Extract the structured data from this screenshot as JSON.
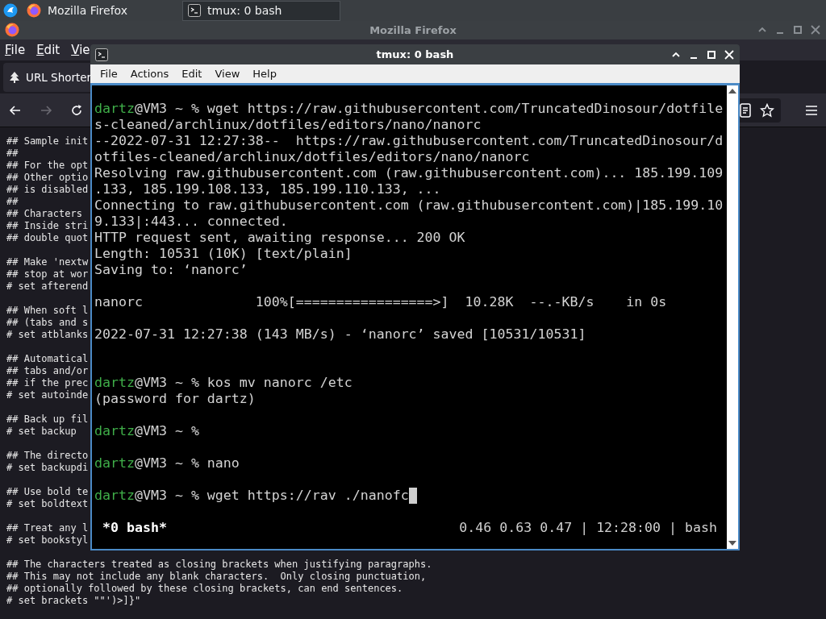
{
  "taskbar": {
    "tasks": [
      {
        "title": "Mozilla Firefox",
        "kind": "browser",
        "selected": false
      },
      {
        "title": "tmux: 0 bash",
        "kind": "terminal",
        "selected": true
      }
    ]
  },
  "firefox": {
    "title": "Mozilla Firefox",
    "menu": [
      "File",
      "Edit",
      "Vie"
    ],
    "tab": {
      "title": "URL Shorter"
    },
    "nav_buttons": [
      {
        "kind": "back",
        "disabled": false
      },
      {
        "kind": "forward",
        "disabled": true
      },
      {
        "kind": "reload",
        "disabled": false
      }
    ],
    "paragraphs": [
      {
        "lines": [
          "## Sample init",
          "##",
          "## For the opt",
          "## Other optio",
          "## is disabled",
          "##",
          "## Characters",
          "## Inside stri",
          "## double quot"
        ]
      },
      {
        "lines": [
          "## Make 'nextw",
          "## stop at wor",
          "# set afterend"
        ]
      },
      {
        "lines": [
          "## When soft l",
          "## (tabs and s",
          "# set atblanks"
        ]
      },
      {
        "lines": [
          "## Automatical",
          "## tabs and/or",
          "## if the prec",
          "# set autoinde"
        ]
      },
      {
        "lines": [
          "## Back up fil",
          "# set backup"
        ]
      },
      {
        "lines": [
          "## The directo",
          "# set backupdi"
        ]
      },
      {
        "lines": [
          "## Use bold te",
          "# set boldtext"
        ]
      },
      {
        "lines": [
          "## Treat any l",
          "# set bookstyl"
        ]
      },
      {
        "lines": [
          "## The characters treated as closing brackets when justifying paragraphs.",
          "## This may not include any blank characters.  Only closing punctuation,",
          "## optionally followed by these closing brackets, can end sentences.",
          "# set brackets \"\"')>]}\""
        ]
      }
    ]
  },
  "terminal": {
    "title": "tmux: 0 bash",
    "menu": [
      "File",
      "Actions",
      "Edit",
      "View",
      "Help"
    ],
    "lines": [
      {
        "kind": "prompt",
        "user": "dartz",
        "prompt": "@VM3 ~ %",
        "command": "wget https://raw.githubusercontent.com/TruncatedDinosour/dotfile",
        "cursor": false
      },
      {
        "kind": "output",
        "text": "s-cleaned/archlinux/dotfiles/editors/nano/nanorc"
      },
      {
        "kind": "output",
        "text": "--2022-07-31 12:27:38--  https://raw.githubusercontent.com/TruncatedDinosour/d"
      },
      {
        "kind": "output",
        "text": "otfiles-cleaned/archlinux/dotfiles/editors/nano/nanorc"
      },
      {
        "kind": "output",
        "text": "Resolving raw.githubusercontent.com (raw.githubusercontent.com)... 185.199.109"
      },
      {
        "kind": "output",
        "text": ".133, 185.199.108.133, 185.199.110.133, ..."
      },
      {
        "kind": "output",
        "text": "Connecting to raw.githubusercontent.com (raw.githubusercontent.com)|185.199.10"
      },
      {
        "kind": "output",
        "text": "9.133|:443... connected."
      },
      {
        "kind": "output",
        "text": "HTTP request sent, awaiting response... 200 OK"
      },
      {
        "kind": "output",
        "text": "Length: 10531 (10K) [text/plain]"
      },
      {
        "kind": "output",
        "text": "Saving to: ‘nanorc’"
      },
      {
        "kind": "blank"
      },
      {
        "kind": "output",
        "text": "nanorc              100%[=================>]  10.28K  --.-KB/s    in 0s"
      },
      {
        "kind": "blank"
      },
      {
        "kind": "output",
        "text": "2022-07-31 12:27:38 (143 MB/s) - ‘nanorc’ saved [10531/10531]"
      },
      {
        "kind": "blank"
      },
      {
        "kind": "blank"
      },
      {
        "kind": "prompt",
        "user": "dartz",
        "prompt": "@VM3 ~ %",
        "command": "kos mv nanorc /etc",
        "cursor": false
      },
      {
        "kind": "output",
        "text": "(password for dartz)"
      },
      {
        "kind": "blank"
      },
      {
        "kind": "prompt",
        "user": "dartz",
        "prompt": "@VM3 ~ %",
        "cursor": false
      },
      {
        "kind": "blank"
      },
      {
        "kind": "prompt",
        "user": "dartz",
        "prompt": "@VM3 ~ %",
        "command": "nano",
        "cursor": false
      },
      {
        "kind": "blank"
      },
      {
        "kind": "prompt",
        "user": "dartz",
        "prompt": "@VM3 ~ %",
        "command": "wget https://rav ./nanofc",
        "cursor": true
      },
      {
        "kind": "blank"
      }
    ],
    "status": {
      "left": "*0 bash*",
      "right": "0.46 0.63 0.47 | 12:28:00 | bash"
    }
  }
}
